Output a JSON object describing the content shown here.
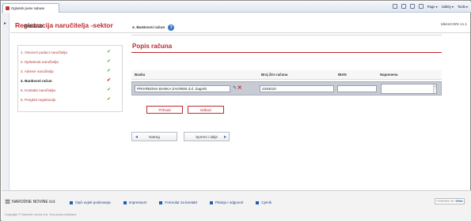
{
  "browser": {
    "tab_title": "Oglasnik javne nabave",
    "toolbar": [
      "Page ▾",
      "Safety ▾",
      "Tools ▾"
    ]
  },
  "header": {
    "title": "Registracija naručitelja -sektor",
    "version": "Ideeo3.Wtc v1.1"
  },
  "steps": {
    "heading": "PREGLED",
    "items": [
      {
        "label": "1. Osnovni podaci naručitelja",
        "state": "done"
      },
      {
        "label": "2. Djelatnost naručitelja",
        "state": "done"
      },
      {
        "label": "3. Adrese naručitelja",
        "state": "done"
      },
      {
        "label": "4. Bankovni račun",
        "state": "active"
      },
      {
        "label": "5. Kontakti naručitelja",
        "state": "done"
      },
      {
        "label": "6. Pregled registracije",
        "state": "done"
      }
    ]
  },
  "section": {
    "heading": "4. Bankovni račun",
    "subheading": "Popis računa"
  },
  "table": {
    "columns": [
      "Banka",
      "Broj žiro računa",
      "IBAN",
      "Napomena"
    ],
    "row": {
      "bank": "PRIVREDNA BANKA ZAGREB d.d. Zagreb",
      "account": "2340010",
      "iban": "",
      "note": ""
    }
  },
  "buttons": {
    "accept": "Prihvati",
    "reject": "Odbaci",
    "back": "Natrag",
    "next": "Spremi i dalje"
  },
  "footer": {
    "logo_text": "NARODNE NOVINE d.d.",
    "links": [
      "Opći uvjeti poslovanja",
      "Impressum",
      "Formular za kontakt",
      "Pitanja i odgovori",
      "Cjenik"
    ],
    "powered_by": "POWERED BY",
    "powered_brand": "SPAN",
    "copyright": "Copyright © Narodne novine d.d. Sva prava pridržana"
  },
  "colors": {
    "accent": "#c0282d",
    "link": "#1d3f8a",
    "check": "#5aa02c"
  }
}
